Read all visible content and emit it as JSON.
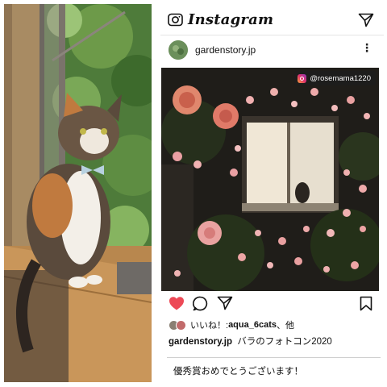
{
  "app": {
    "brand": "Instagram",
    "icons": {
      "camera": "camera-icon",
      "direct": "paper-plane-icon"
    }
  },
  "post": {
    "username": "gardenstory.jp",
    "tag": "@rosemama1220",
    "likes": {
      "prefix": "いいね！: ",
      "user": "aqua_6cats",
      "suffix": "、他"
    },
    "caption": {
      "user": "gardenstory.jp",
      "text": "バラのフォトコン2020"
    },
    "comment": "優秀賞おめでとうございます！"
  },
  "colors": {
    "heart": "#ed4956",
    "text": "#111111",
    "divider": "#cfcfcf"
  }
}
